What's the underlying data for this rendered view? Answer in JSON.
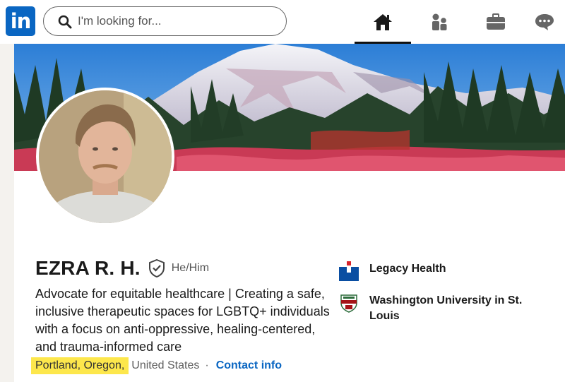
{
  "nav": {
    "logo_text": "in",
    "search_placeholder": "I'm looking for...",
    "items": [
      {
        "name": "home",
        "active": true
      },
      {
        "name": "my-network",
        "active": false
      },
      {
        "name": "jobs",
        "active": false
      },
      {
        "name": "messaging",
        "active": false
      }
    ]
  },
  "profile": {
    "name": "EZRA R. H.",
    "pronouns": "He/Him",
    "headline": "Advocate for equitable healthcare | Creating a safe, inclusive therapeutic spaces for LGBTQ+ individuals with a focus on anti-oppressive, healing-centered, and trauma-informed care",
    "location_highlight": "Portland, Oregon,",
    "location_rest": "United States",
    "separator": "·",
    "contact_label": "Contact info"
  },
  "organizations": [
    {
      "name": "Legacy Health",
      "logo_color": "#0a4ea2"
    },
    {
      "name": "Washington University in St. Louis",
      "logo_color": "#a51417"
    }
  ],
  "colors": {
    "brand": "#0a66c2",
    "highlight": "#fde74c"
  }
}
